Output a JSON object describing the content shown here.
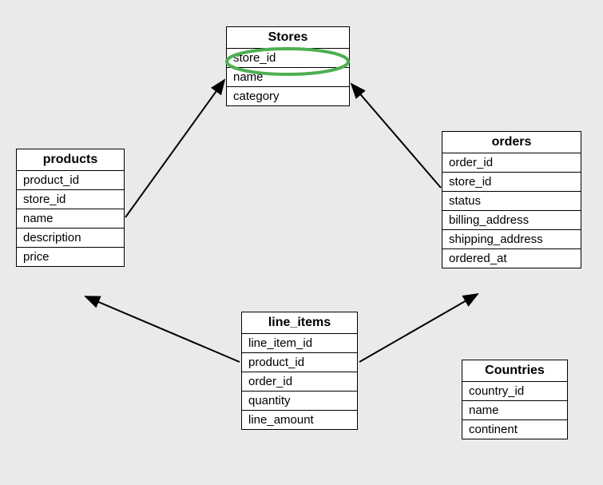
{
  "entities": {
    "stores": {
      "title": "Stores",
      "fields": [
        "store_id",
        "name",
        "category"
      ]
    },
    "products": {
      "title": "products",
      "fields": [
        "product_id",
        "store_id",
        "name",
        "description",
        "price"
      ]
    },
    "orders": {
      "title": "orders",
      "fields": [
        "order_id",
        "store_id",
        "status",
        "billing_address",
        "shipping_address",
        "ordered_at"
      ]
    },
    "line_items": {
      "title": "line_items",
      "fields": [
        "line_item_id",
        "product_id",
        "order_id",
        "quantity",
        "line_amount"
      ]
    },
    "countries": {
      "title": "Countries",
      "fields": [
        "country_id",
        "name",
        "continent"
      ]
    }
  },
  "highlight": {
    "field": "store_id",
    "color": "#4CAF50"
  },
  "relationships": [
    {
      "from": "products",
      "to": "stores"
    },
    {
      "from": "orders",
      "to": "stores"
    },
    {
      "from": "line_items",
      "to": "products"
    },
    {
      "from": "line_items",
      "to": "orders"
    }
  ]
}
